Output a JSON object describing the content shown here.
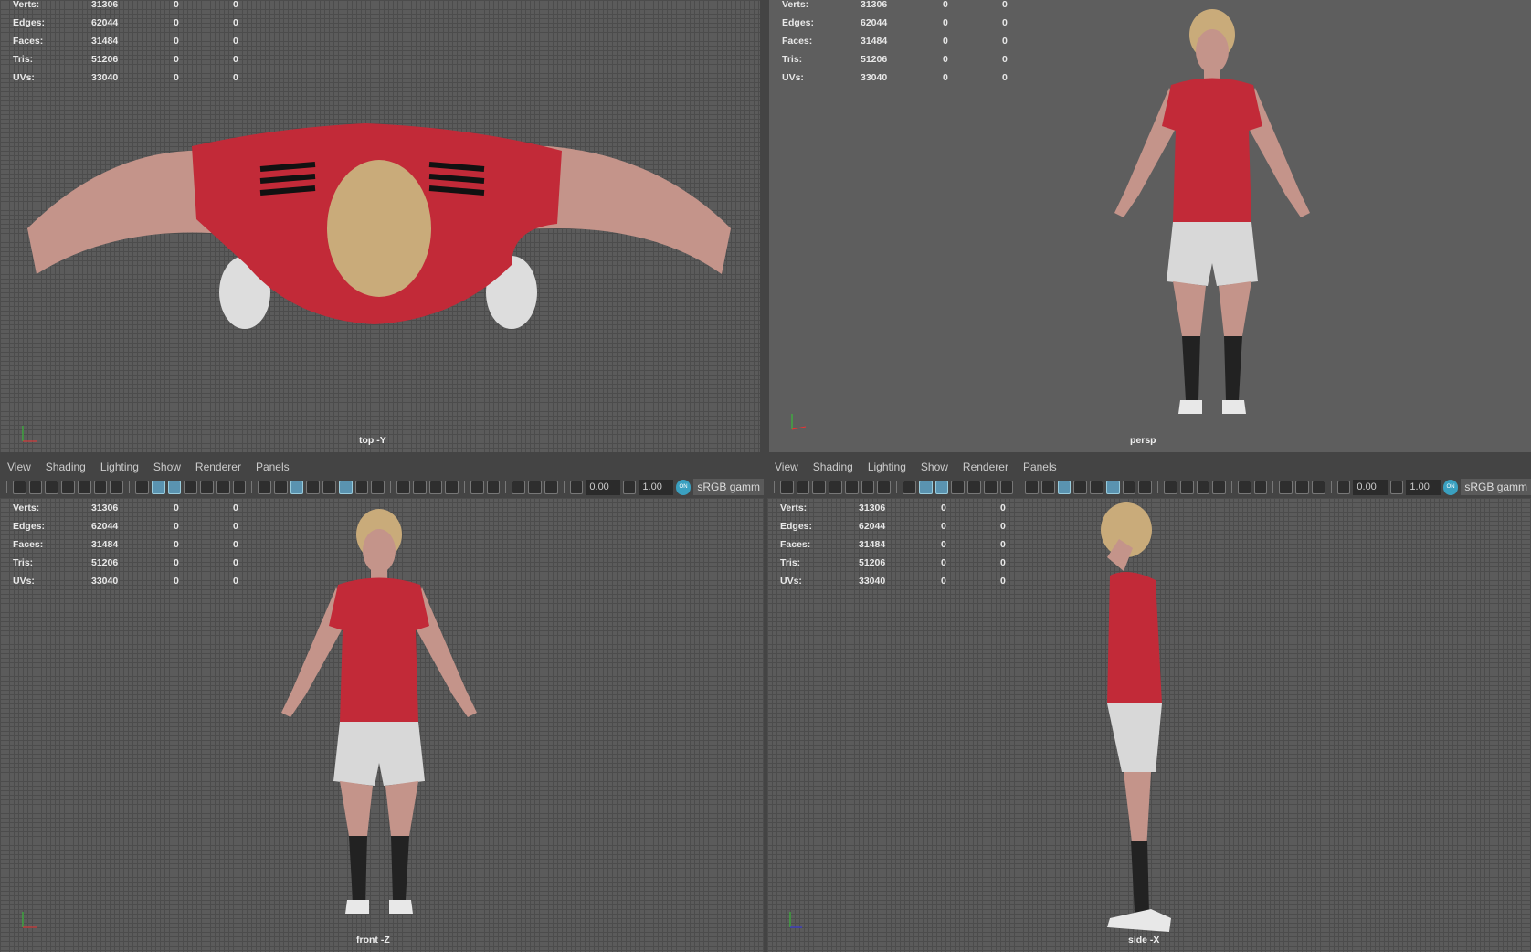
{
  "menu": [
    "View",
    "Shading",
    "Lighting",
    "Show",
    "Renderer",
    "Panels"
  ],
  "toolbar": {
    "exposure": "0.00",
    "gamma": "1.00",
    "on_label": "ON",
    "color_space": "sRGB gamm"
  },
  "hud": {
    "labels": [
      "Verts:",
      "Edges:",
      "Faces:",
      "Tris:",
      "UVs:"
    ],
    "values": [
      "31306",
      "62044",
      "31484",
      "51206",
      "33040"
    ],
    "col2": [
      "0",
      "0",
      "0",
      "0",
      "0"
    ],
    "col3": [
      "0",
      "0",
      "0",
      "0",
      "0"
    ]
  },
  "viewports": {
    "top": "top -Y",
    "persp": "persp",
    "front": "front -Z",
    "side": "side -X"
  },
  "axes": {
    "x": "x",
    "y": "y",
    "z": "z"
  },
  "colors": {
    "shirt": "#c22a38",
    "shorts": "#d8d8d8",
    "socks": "#222222",
    "skin": "#c4948a",
    "hair": "#c9ab7a",
    "accent": "#5a93b0"
  }
}
